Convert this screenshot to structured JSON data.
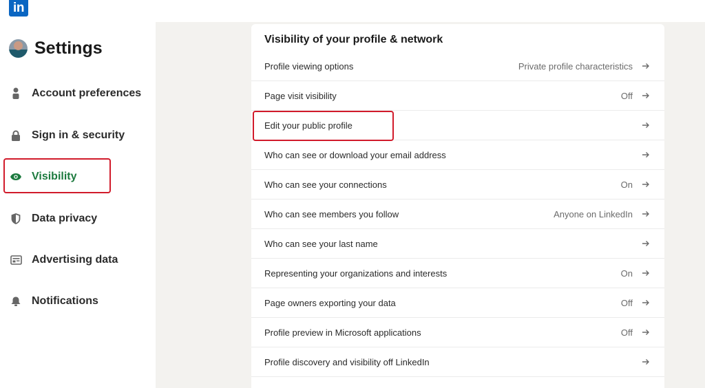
{
  "topbar": {
    "logo_text": "in"
  },
  "sidebar": {
    "title": "Settings",
    "items": [
      {
        "label": "Account preferences",
        "icon": "person-icon",
        "active": false
      },
      {
        "label": "Sign in & security",
        "icon": "lock-icon",
        "active": false
      },
      {
        "label": "Visibility",
        "icon": "eye-icon",
        "active": true
      },
      {
        "label": "Data privacy",
        "icon": "shield-icon",
        "active": false
      },
      {
        "label": "Advertising data",
        "icon": "ad-card-icon",
        "active": false
      },
      {
        "label": "Notifications",
        "icon": "bell-icon",
        "active": false
      }
    ]
  },
  "main": {
    "section_title": "Visibility of your profile & network",
    "rows": [
      {
        "label": "Profile viewing options",
        "value": "Private profile characteristics"
      },
      {
        "label": "Page visit visibility",
        "value": "Off"
      },
      {
        "label": "Edit your public profile",
        "value": ""
      },
      {
        "label": "Who can see or download your email address",
        "value": ""
      },
      {
        "label": "Who can see your connections",
        "value": "On"
      },
      {
        "label": "Who can see members you follow",
        "value": "Anyone on LinkedIn"
      },
      {
        "label": "Who can see your last name",
        "value": ""
      },
      {
        "label": "Representing your organizations and interests",
        "value": "On"
      },
      {
        "label": "Page owners exporting your data",
        "value": "Off"
      },
      {
        "label": "Profile preview in Microsoft applications",
        "value": "Off"
      },
      {
        "label": "Profile discovery and visibility off LinkedIn",
        "value": ""
      }
    ]
  },
  "colors": {
    "brand": "#0a66c2",
    "active_nav": "#1c7a3e",
    "highlight_box": "#d11a2a",
    "page_bg": "#f3f2ef"
  }
}
